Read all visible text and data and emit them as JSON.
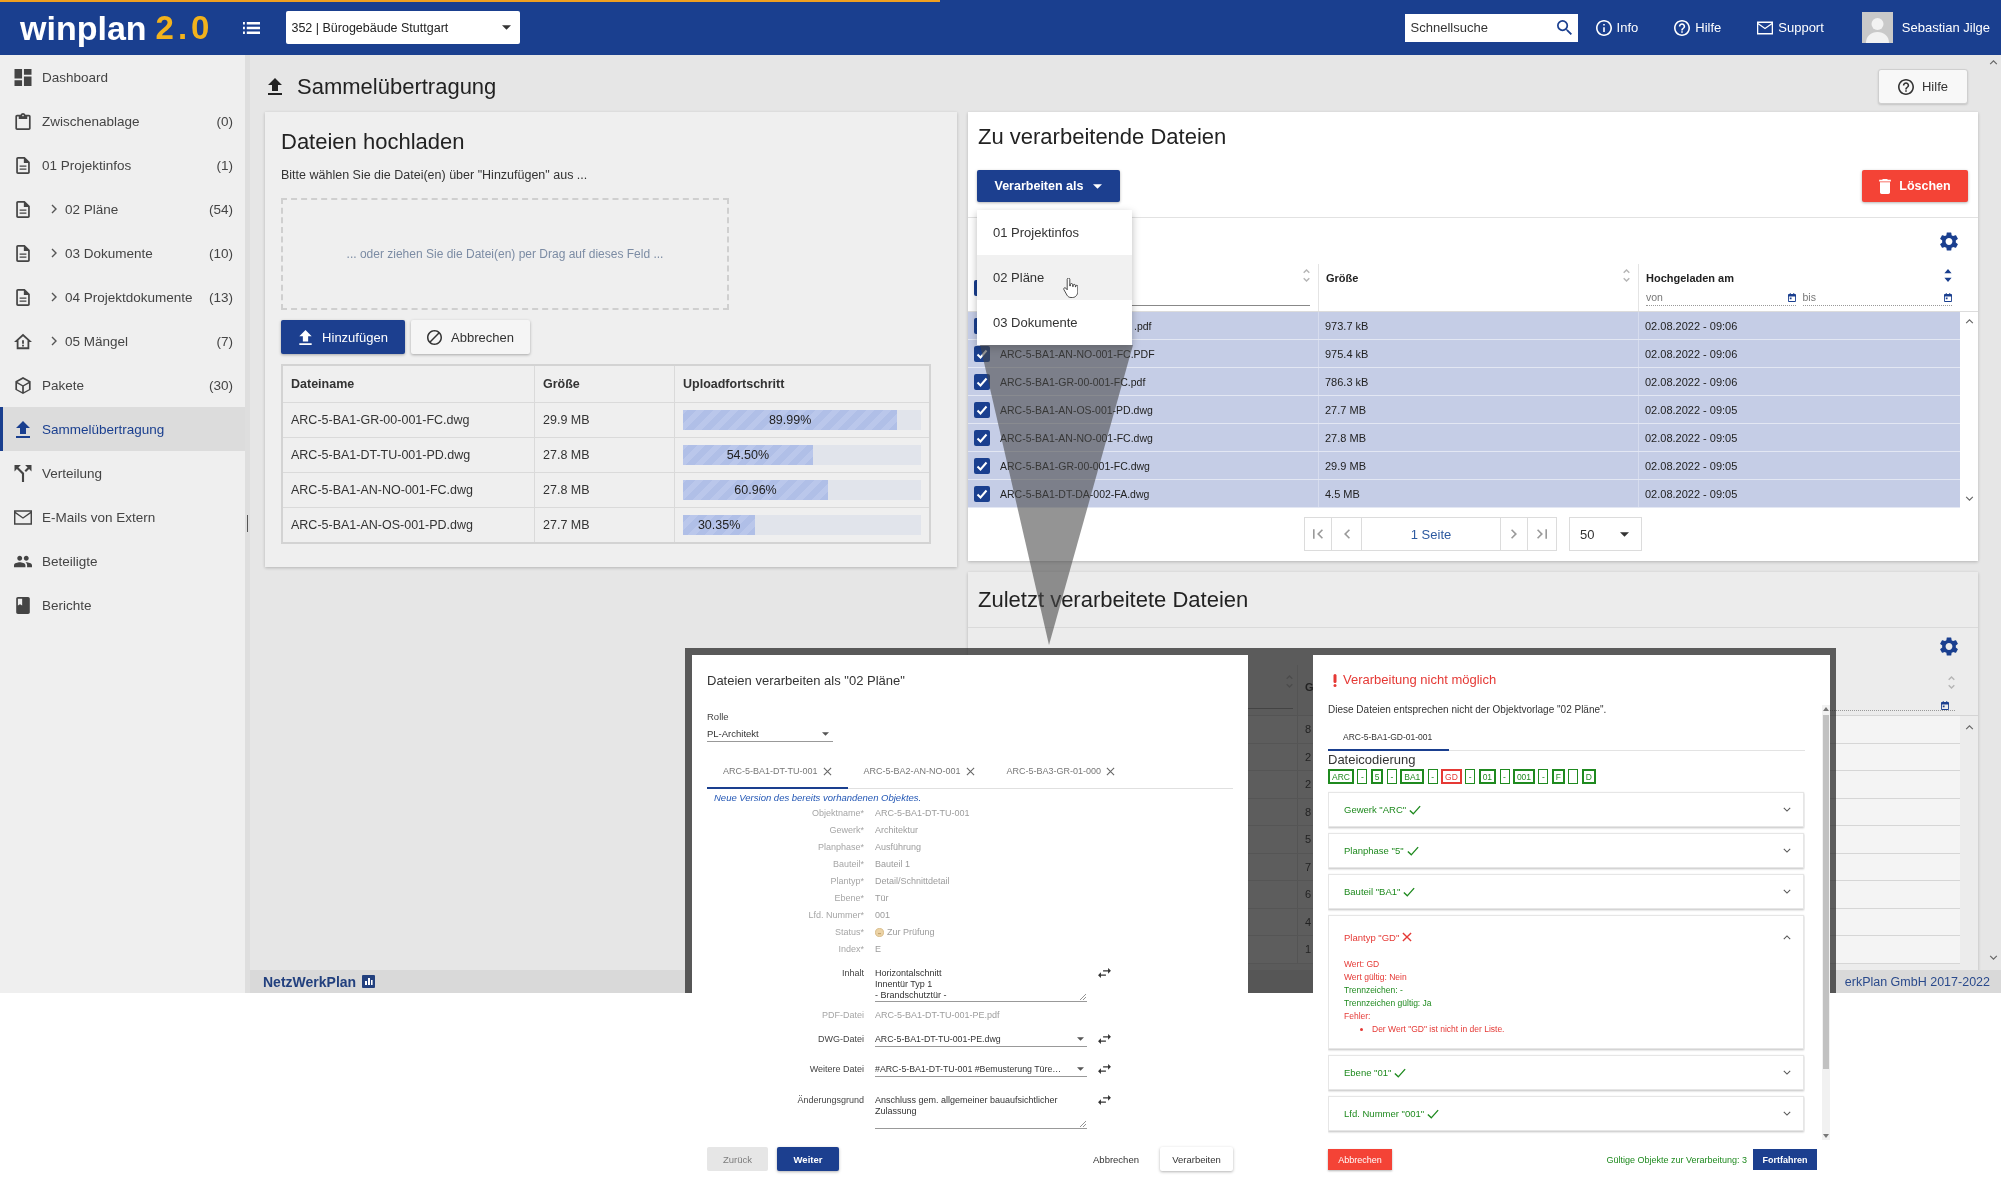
{
  "loading_bar": {
    "level": 0.47
  },
  "header": {
    "logo": "winplan",
    "logo_version": "2.0",
    "project": "352 | Bürogebäude Stuttgart",
    "search": {
      "placeholder": "Schnellsuche"
    },
    "links": [
      {
        "label": "Info"
      },
      {
        "label": "Hilfe"
      },
      {
        "label": "Support"
      }
    ],
    "user": "Sebastian Jilge"
  },
  "sidebar": {
    "items": [
      {
        "label": "Dashboard",
        "expandable": false,
        "selected": false
      },
      {
        "label": "Zwischenablage",
        "count": "(0)",
        "expandable": false,
        "selected": false
      },
      {
        "label": "01 Projektinfos",
        "count": "(1)",
        "expandable": false,
        "selected": false
      },
      {
        "label": "02 Pläne",
        "count": "(54)",
        "expandable": true,
        "selected": false
      },
      {
        "label": "03 Dokumente",
        "count": "(10)",
        "expandable": true,
        "selected": false
      },
      {
        "label": "04 Projektdokumente",
        "count": "(13)",
        "expandable": true,
        "selected": false
      },
      {
        "label": "05 Mängel",
        "count": "(7)",
        "expandable": true,
        "selected": false
      },
      {
        "label": "Pakete",
        "count": "(30)",
        "expandable": false,
        "selected": false
      },
      {
        "label": "Sammelübertragung",
        "expandable": false,
        "selected": true
      },
      {
        "label": "Verteilung",
        "expandable": false,
        "selected": false
      },
      {
        "label": "E-Mails von Extern",
        "expandable": false,
        "selected": false
      },
      {
        "label": "Beteiligte",
        "expandable": false,
        "selected": false
      },
      {
        "label": "Berichte",
        "expandable": false,
        "selected": false
      }
    ]
  },
  "page": {
    "title": "Sammelübertragung",
    "help_button": "Hilfe"
  },
  "upload": {
    "title": "Dateien hochladen",
    "instruction": "Bitte wählen Sie die Datei(en) über \"Hinzufügen\" aus ...",
    "dropzone": "... oder ziehen Sie die Datei(en) per Drag auf dieses Feld ...",
    "buttons": [
      {
        "label": "Hinzufügen",
        "kind": "primary"
      },
      {
        "label": "Abbrechen",
        "kind": "secondary"
      }
    ],
    "table": {
      "columns": [
        "Dateiname",
        "Größe",
        "Uploadfortschritt"
      ],
      "rows": [
        {
          "name": "ARC-5-BA1-GR-00-001-FC.dwg",
          "size": "29.9 MB",
          "level": 0.8999,
          "progress": "89.99%"
        },
        {
          "name": "ARC-5-BA1-DT-TU-001-PD.dwg",
          "size": "27.8 MB",
          "level": 0.545,
          "progress": "54.50%"
        },
        {
          "name": "ARC-5-BA1-AN-NO-001-FC.dwg",
          "size": "27.8 MB",
          "level": 0.6096,
          "progress": "60.96%"
        },
        {
          "name": "ARC-5-BA1-AN-OS-001-PD.dwg",
          "size": "27.7 MB",
          "level": 0.3035,
          "progress": "30.35%"
        }
      ]
    }
  },
  "pending": {
    "title": "Zu verarbeitende Dateien",
    "process_button": "Verarbeiten als",
    "delete_button": "Löschen",
    "menu": {
      "items": [
        {
          "label": "01 Projektinfos",
          "hovered": false
        },
        {
          "label": "02 Pläne",
          "hovered": true
        },
        {
          "label": "03 Dokumente",
          "hovered": false
        }
      ]
    },
    "table": {
      "all_checked": true,
      "name_column": {
        "sorted": false
      },
      "size_column": {
        "label": "Größe",
        "sorted": false
      },
      "date_column": {
        "label": "Hochgeladen am",
        "sorted": true,
        "from": {
          "placeholder": "von"
        },
        "to": {
          "placeholder": "bis"
        }
      },
      "rows": [
        {
          "name": ".pdf",
          "partly_covered": true,
          "size": "973.7 kB",
          "uploaded": "02.08.2022 - 09:06",
          "checked": true
        },
        {
          "name": "ARC-5-BA1-AN-NO-001-FC.PDF",
          "partly_covered": false,
          "size": "975.4 kB",
          "uploaded": "02.08.2022 - 09:06",
          "checked": true
        },
        {
          "name": "ARC-5-BA1-GR-00-001-FC.pdf",
          "partly_covered": false,
          "size": "786.3 kB",
          "uploaded": "02.08.2022 - 09:06",
          "checked": true
        },
        {
          "name": "ARC-5-BA1-AN-OS-001-PD.dwg",
          "partly_covered": false,
          "size": "27.7 MB",
          "uploaded": "02.08.2022 - 09:05",
          "checked": true
        },
        {
          "name": "ARC-5-BA1-AN-NO-001-FC.dwg",
          "partly_covered": false,
          "size": "27.8 MB",
          "uploaded": "02.08.2022 - 09:05",
          "checked": true
        },
        {
          "name": "ARC-5-BA1-GR-00-001-FC.dwg",
          "partly_covered": false,
          "size": "29.9 MB",
          "uploaded": "02.08.2022 - 09:05",
          "checked": true
        },
        {
          "name": "ARC-5-BA1-DT-DA-002-FA.dwg",
          "partly_covered": false,
          "size": "4.5 MB",
          "uploaded": "02.08.2022 - 09:05",
          "checked": true
        }
      ]
    },
    "pager": {
      "page": "1 Seite",
      "page_size": "50"
    }
  },
  "recent": {
    "title": "Zuletzt verarbeitete Dateien",
    "table": {
      "name_column": {
        "sorted": false
      },
      "size_column": {
        "label": "G"
      },
      "date_column": {
        "sorted": false
      },
      "rows": [
        {
          "size": "8"
        },
        {
          "size": "2"
        },
        {
          "size": "2"
        },
        {
          "size": "8"
        },
        {
          "size": "5"
        },
        {
          "size": "7"
        },
        {
          "size": "6"
        },
        {
          "size": "4"
        },
        {
          "size": "1"
        }
      ]
    }
  },
  "footer": {
    "brand": "NetzWerkPlan",
    "copyright": "erkPlan GmbH 2017-2022"
  },
  "process_dialog": {
    "title": "Dateien verarbeiten als \"02 Pläne\"",
    "role": {
      "label": "Rolle",
      "value": "PL-Architekt"
    },
    "tabs": [
      {
        "label": "ARC-5-BA1-DT-TU-001",
        "selected": true
      },
      {
        "label": "ARC-5-BA2-AN-NO-001",
        "selected": false
      },
      {
        "label": "ARC-5-BA3-GR-01-000",
        "selected": false
      }
    ],
    "notice": "Neue Version des bereits vorhandenen Objektes.",
    "fields": [
      {
        "label": "Objektname*",
        "value": "ARC-5-BA1-DT-TU-001",
        "kind": "text",
        "disabled": true
      },
      {
        "label": "Gewerk*",
        "value": "Architektur",
        "kind": "text",
        "disabled": true
      },
      {
        "label": "Planphase*",
        "value": "Ausführung",
        "kind": "text",
        "disabled": true
      },
      {
        "label": "Bauteil*",
        "value": "Bauteil 1",
        "kind": "text",
        "disabled": true
      },
      {
        "label": "Plantyp*",
        "value": "Detail/Schnittdetail",
        "kind": "text",
        "disabled": true
      },
      {
        "label": "Ebene*",
        "value": "Tür",
        "kind": "text",
        "disabled": true
      },
      {
        "label": "Lfd. Nummer*",
        "value": "001",
        "kind": "text",
        "disabled": true
      },
      {
        "label": "Status*",
        "value": "Zur Prüfung",
        "kind": "status",
        "disabled": true
      },
      {
        "label": "Index*",
        "value": "E",
        "kind": "text",
        "disabled": true
      },
      {
        "label": "Inhalt",
        "value": "Horizontalschnitt\nInnentür Typ 1\n- Brandschutztür -",
        "kind": "textarea",
        "disabled": false
      },
      {
        "label": "PDF-Datei",
        "value": "ARC-5-BA1-DT-TU-001-PE.pdf",
        "kind": "text",
        "disabled": true
      },
      {
        "label": "DWG-Datei",
        "value": "ARC-5-BA1-DT-TU-001-PE.dwg",
        "kind": "select",
        "disabled": false
      },
      {
        "label": "Weitere Datei",
        "value": "#ARC-5-BA1-DT-TU-001 #Bemusterung Türe…",
        "kind": "select",
        "disabled": false
      },
      {
        "label": "Änderungsgrund",
        "value": "Anschluss gem. allgemeiner bauaufsichtlicher Zulassung",
        "kind": "textarea",
        "disabled": false
      }
    ],
    "buttons": [
      {
        "label": "Zurück",
        "kind": "flat",
        "disabled": true
      },
      {
        "label": "Weiter",
        "kind": "primary",
        "disabled": false
      },
      {
        "label": "Abbrechen",
        "kind": "text",
        "disabled": false
      },
      {
        "label": "Verarbeiten",
        "kind": "raised",
        "disabled": false
      }
    ]
  },
  "error_dialog": {
    "title": "Verarbeitung nicht möglich",
    "message": "Diese Dateien entsprechen nicht der Objektvorlage \"02 Pläne\".",
    "tabs": [
      {
        "label": "ARC-5-BA1-GD-01-001",
        "selected": true
      }
    ],
    "coding_title": "Dateicodierung",
    "code_parts": [
      {
        "text": "ARC",
        "kind": "segment",
        "valid": true
      },
      {
        "text": "-",
        "kind": "separator",
        "valid": true
      },
      {
        "text": "5",
        "kind": "segment",
        "valid": true
      },
      {
        "text": "-",
        "kind": "separator",
        "valid": true
      },
      {
        "text": "BA1",
        "kind": "segment",
        "valid": true
      },
      {
        "text": "-",
        "kind": "separator",
        "valid": true
      },
      {
        "text": "GD",
        "kind": "segment",
        "valid": false
      },
      {
        "text": "-",
        "kind": "separator",
        "valid": true
      },
      {
        "text": "01",
        "kind": "segment",
        "valid": true
      },
      {
        "text": "-",
        "kind": "separator",
        "valid": true
      },
      {
        "text": "001",
        "kind": "segment",
        "valid": true
      },
      {
        "text": "-",
        "kind": "separator",
        "valid": true
      },
      {
        "text": "F",
        "kind": "segment",
        "valid": true
      },
      {
        "kind": "separator",
        "valid": true
      },
      {
        "text": "D",
        "kind": "segment",
        "valid": true
      }
    ],
    "checks": [
      {
        "title": "Gewerk \"ARC\"",
        "valid": true,
        "expanded": false
      },
      {
        "title": "Planphase \"5\"",
        "valid": true,
        "expanded": false
      },
      {
        "title": "Bauteil \"BA1\"",
        "valid": true,
        "expanded": false
      },
      {
        "title": "Plantyp \"GD\"",
        "valid": false,
        "expanded": true,
        "details": [
          {
            "text": "Wert: GD",
            "valid": false
          },
          {
            "text": "Wert gültig: Nein",
            "valid": false
          },
          {
            "text": "Trennzeichen: -",
            "valid": true
          },
          {
            "text": "Trennzeichen gültig: Ja",
            "valid": true
          },
          {
            "text": "Fehler:",
            "valid": false
          }
        ],
        "errors": [
          "Der Wert \"GD\" ist nicht in der Liste."
        ]
      },
      {
        "title": "Ebene \"01\"",
        "valid": true,
        "expanded": false
      },
      {
        "title": "Lfd. Nummer \"001\"",
        "valid": true,
        "expanded": false
      }
    ],
    "cancel_button": "Abbrechen",
    "summary": "Gültige Objekte zur Verarbeitung: 3",
    "continue_button": "Fortfahren"
  }
}
